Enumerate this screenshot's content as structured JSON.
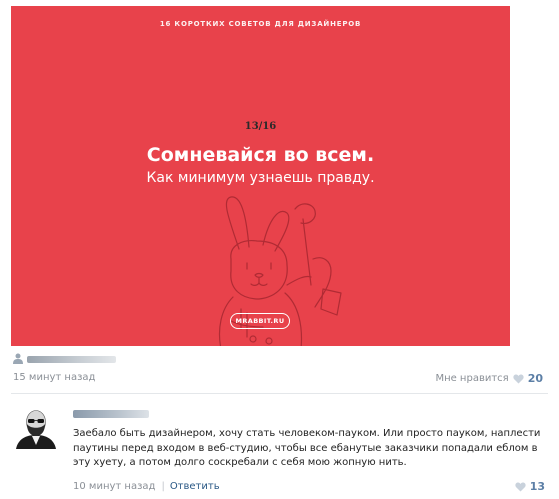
{
  "post": {
    "poster": {
      "header": "16 КОРОТКИХ СОВЕТОВ ДЛЯ ДИЗАЙНЕРОВ",
      "counter": "13/16",
      "headline": "Сомневайся во всем.",
      "subline": "Как минимум узнаешь правду.",
      "badge": "MRABBIT.RU",
      "background_color": "#e8424b"
    },
    "time": "15 минут назад",
    "like_label": "Мне нравится",
    "like_count": "20"
  },
  "comment": {
    "text": "Заебало быть дизайнером, хочу стать человеком-пауком. Или просто пауком, наплести паутины перед входом в веб-студию, чтобы все ебанутые заказчики попадали еблом в эту хуету, а потом долго соскребали с себя мою жопную нить.",
    "time": "10 минут назад",
    "separator": "|",
    "reply_label": "Ответить",
    "like_count": "13"
  },
  "colors": {
    "link": "#2a5885",
    "like_count": "#5c7fa6",
    "meta_text": "#8a8f96"
  },
  "icons": [
    "user-icon",
    "heart-icon",
    "bunny-illustration",
    "avatar-sunglasses-man"
  ]
}
